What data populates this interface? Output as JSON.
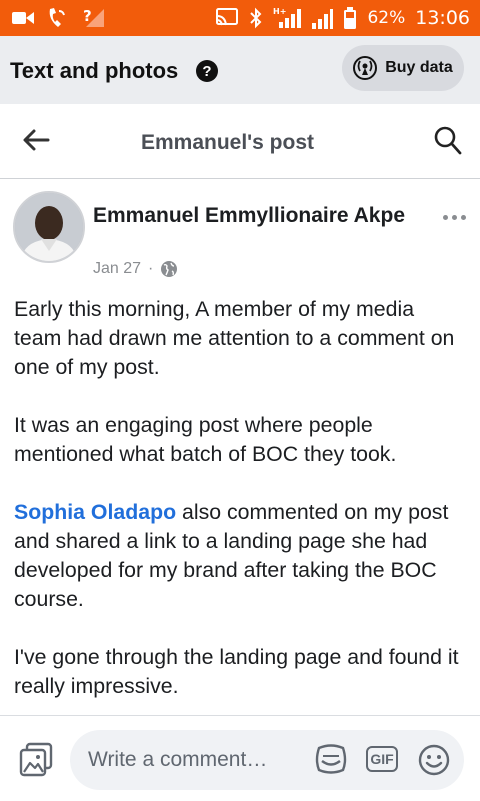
{
  "status_bar": {
    "battery": "62%",
    "time": "13:06",
    "network_label": "H+"
  },
  "mode_bar": {
    "title": "Text and photos",
    "help_glyph": "?",
    "buy_data_label": "Buy data"
  },
  "nav": {
    "title": "Emmanuel's post"
  },
  "post": {
    "author": "Emmanuel Emmyllionaire Akpe",
    "date": "Jan 27",
    "separator": "·",
    "privacy_icon": "globe-icon",
    "paragraphs": {
      "p1": "Early this morning, A member of my media team had drawn me attention to a comment on one of my post.",
      "p2": "It was an engaging post where people mentioned what batch of BOC they took.",
      "p3_mention": "Sophia Oladapo",
      "p3_rest": " also commented on my post and shared a link to a landing page she had developed for my brand after taking the BOC course.",
      "p4": "I've gone through the landing page and found it really impressive."
    }
  },
  "composer": {
    "placeholder": "Write a comment…",
    "gif_label": "GIF"
  },
  "colors": {
    "status_bar": "#f25c0b",
    "mode_bar": "#ebedf0",
    "mention": "#216fdb"
  }
}
